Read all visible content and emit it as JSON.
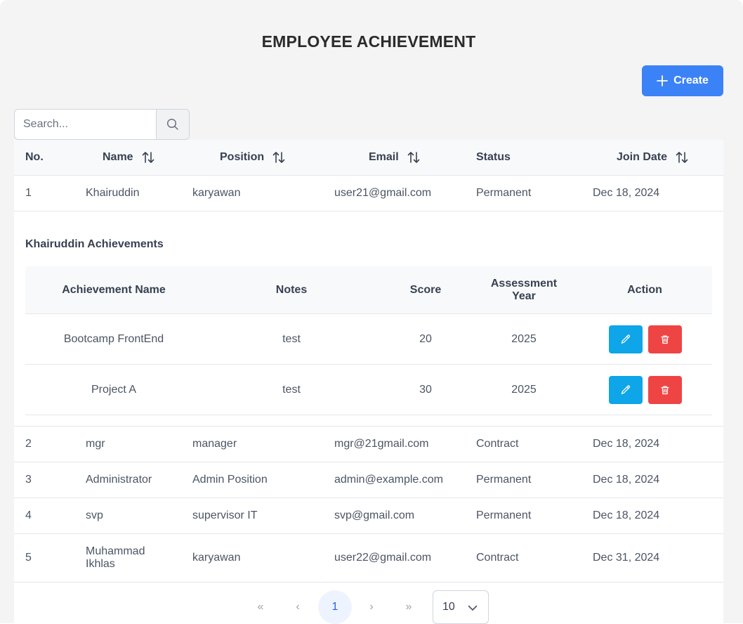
{
  "page_title": "EMPLOYEE ACHIEVEMENT",
  "create_label": "Create",
  "search": {
    "placeholder": "Search..."
  },
  "columns": {
    "no": "No.",
    "name": "Name",
    "position": "Position",
    "email": "Email",
    "status": "Status",
    "join_date": "Join Date"
  },
  "employees": [
    {
      "no": "1",
      "name": "Khairuddin",
      "position": "karyawan",
      "email": "user21@gmail.com",
      "status": "Permanent",
      "join_date": "Dec 18, 2024"
    },
    {
      "no": "2",
      "name": "mgr",
      "position": "manager",
      "email": "mgr@21gmail.com",
      "status": "Contract",
      "join_date": "Dec 18, 2024"
    },
    {
      "no": "3",
      "name": "Administrator",
      "position": "Admin Position",
      "email": "admin@example.com",
      "status": "Permanent",
      "join_date": "Dec 18, 2024"
    },
    {
      "no": "4",
      "name": "svp",
      "position": "supervisor IT",
      "email": "svp@gmail.com",
      "status": "Permanent",
      "join_date": "Dec 18, 2024"
    },
    {
      "no": "5",
      "name": "Muhammad Ikhlas",
      "position": "karyawan",
      "email": "user22@gmail.com",
      "status": "Contract",
      "join_date": "Dec 31, 2024"
    }
  ],
  "expanded": {
    "title": "Khairuddin Achievements",
    "columns": {
      "name": "Achievement Name",
      "notes": "Notes",
      "score": "Score",
      "year": "Assessment Year",
      "action": "Action"
    },
    "rows": [
      {
        "name": "Bootcamp FrontEnd",
        "notes": "test",
        "score": "20",
        "year": "2025"
      },
      {
        "name": "Project A",
        "notes": "test",
        "score": "30",
        "year": "2025"
      }
    ]
  },
  "pagination": {
    "first": "«",
    "prev": "‹",
    "current": "1",
    "next": "›",
    "last": "»",
    "rows_per_page": "10"
  },
  "colors": {
    "primary": "#3b82f6",
    "edit": "#0ea5e9",
    "delete": "#ef4444"
  },
  "icons": {
    "create": "plus-icon",
    "search": "search-icon",
    "sort": "sort-icon",
    "edit": "pencil-icon",
    "delete": "trash-icon",
    "dropdown": "chevron-down-icon"
  }
}
